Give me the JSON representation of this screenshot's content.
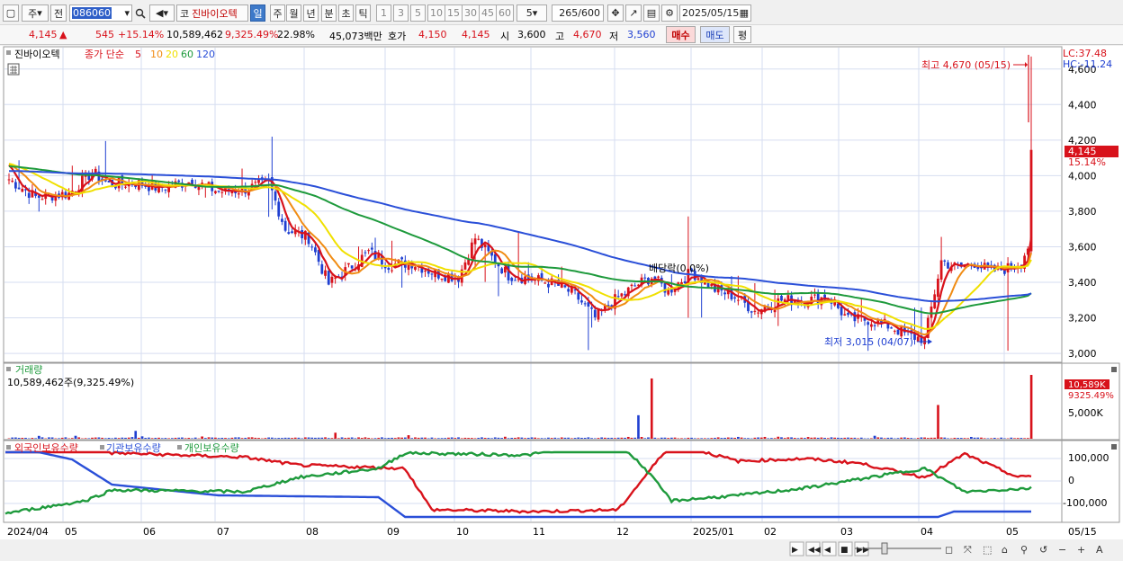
{
  "toolbar": {
    "market": "주",
    "prev": "전",
    "code": "086060",
    "company": "진바이오텍",
    "company_prefix": "코",
    "periods": [
      "일",
      "주",
      "월",
      "년",
      "분",
      "초",
      "틱"
    ],
    "active_period": "일",
    "minutes": [
      "1",
      "3",
      "5",
      "10",
      "15",
      "30",
      "45",
      "60"
    ],
    "minute_value": "5",
    "count": "265",
    "count_max": "/600",
    "date": "2025/05/15"
  },
  "quote": {
    "price": "4,145",
    "change": "545",
    "change_pct": "+15.14%",
    "volume": "10,589,462",
    "volume_pct": "9,325.49%",
    "turnover": "22.98%",
    "amount": "45,073백만",
    "ask_label": "호가",
    "ask1": "4,150",
    "ask2": "4,145",
    "open_label": "시",
    "open": "3,600",
    "high_label": "고",
    "high": "4,670",
    "low_label": "저",
    "low": "3,560",
    "buy": "매수",
    "sell": "매도",
    "eval": "평"
  },
  "price_panel": {
    "name": "진바이오텍",
    "ma_label": "종가 단순",
    "ma_periods": [
      "5",
      "10",
      "20",
      "60",
      "120"
    ],
    "ma_colors": [
      "#d8121b",
      "#f08c14",
      "#f0e000",
      "#1e9a3c",
      "#2a4fd8"
    ],
    "lc": "LC:37.48",
    "hc": "HC:-11.24",
    "last_price": "4,145",
    "last_pct": "15.14%",
    "high_note": "최고 4,670 (05/15)",
    "low_note": "최저 3,015 (04/07)",
    "dividend_note": "배당락(0.0%)"
  },
  "volume_panel": {
    "title": "거래량",
    "value_text": "10,589,462주(9,325.49%)",
    "last_k": "10,589K",
    "last_pct": "9325.49%",
    "tick": "5,000K"
  },
  "holdings_panel": {
    "series_names": [
      "외국인보유수량",
      "기관보유수량",
      "개인보유수량"
    ],
    "series_colors": [
      "#d8121b",
      "#2a4fd8",
      "#1e9a3c"
    ],
    "ticks": [
      "100,000",
      "0",
      "-100,000"
    ]
  },
  "x_axis": {
    "labels": [
      "2024/04",
      "05",
      "06",
      "07",
      "08",
      "09",
      "10",
      "11",
      "12",
      "2025/01",
      "02",
      "03",
      "04",
      "05"
    ],
    "right_label": "05/15"
  },
  "chart_data": {
    "type": "line",
    "title": "진바이오텍",
    "xlabel": "",
    "ylabel": "",
    "ylim": [
      2960,
      4700
    ],
    "y_ticks": [
      3000,
      3200,
      3400,
      3600,
      3800,
      4000,
      4200,
      4400,
      4600
    ],
    "x_months": [
      "2024/04",
      "05",
      "06",
      "07",
      "08",
      "09",
      "10",
      "11",
      "12",
      "2025/01",
      "02",
      "03",
      "04",
      "05"
    ],
    "close_anchors": [
      [
        0,
        3980
      ],
      [
        8,
        3880
      ],
      [
        18,
        3900
      ],
      [
        25,
        4020
      ],
      [
        30,
        3950
      ],
      [
        38,
        3960
      ],
      [
        45,
        3930
      ],
      [
        55,
        3970
      ],
      [
        63,
        3910
      ],
      [
        70,
        3920
      ],
      [
        78,
        3960
      ],
      [
        83,
        3700
      ],
      [
        90,
        3650
      ],
      [
        96,
        3390
      ],
      [
        102,
        3480
      ],
      [
        108,
        3570
      ],
      [
        114,
        3500
      ],
      [
        121,
        3510
      ],
      [
        128,
        3450
      ],
      [
        135,
        3430
      ],
      [
        140,
        3650
      ],
      [
        144,
        3560
      ],
      [
        150,
        3440
      ],
      [
        157,
        3420
      ],
      [
        164,
        3390
      ],
      [
        170,
        3330
      ],
      [
        176,
        3200
      ],
      [
        182,
        3300
      ],
      [
        188,
        3380
      ],
      [
        193,
        3430
      ],
      [
        198,
        3350
      ],
      [
        205,
        3460
      ],
      [
        212,
        3360
      ],
      [
        218,
        3320
      ],
      [
        224,
        3240
      ],
      [
        232,
        3300
      ],
      [
        240,
        3300
      ],
      [
        246,
        3320
      ],
      [
        252,
        3190
      ],
      [
        258,
        3190
      ],
      [
        265,
        3150
      ],
      [
        270,
        3100
      ],
      [
        275,
        3080
      ],
      [
        280,
        3520
      ],
      [
        285,
        3480
      ],
      [
        290,
        3510
      ],
      [
        295,
        3460
      ],
      [
        300,
        3480
      ],
      [
        304,
        3520
      ],
      [
        306,
        3600
      ],
      [
        307,
        4145
      ]
    ],
    "events": {
      "high": 4670,
      "high_date": "05/15",
      "low": 3015,
      "low_date": "04/07",
      "last": 4145
    },
    "volume_spikes": [
      {
        "month": "11",
        "value": 10000
      },
      {
        "month": "04",
        "value": 5600
      },
      {
        "month": "05/15",
        "value": 10589
      }
    ],
    "holdings": {
      "series": [
        {
          "name": "외국인보유수량",
          "anchors": [
            [
              0,
              1
            ],
            [
              30,
              0.9
            ],
            [
              40,
              0.78
            ],
            [
              90,
              0.66
            ],
            [
              110,
              0.44
            ],
            [
              150,
              0.35
            ],
            [
              160,
              -0.8
            ],
            [
              200,
              -0.85
            ],
            [
              230,
              -0.8
            ],
            [
              250,
              1.05
            ],
            [
              275,
              0.55
            ],
            [
              300,
              0.62
            ],
            [
              320,
              0.5
            ],
            [
              345,
              0.1
            ],
            [
              360,
              0.75
            ],
            [
              380,
              0.1
            ],
            [
              385,
              0.15
            ]
          ]
        },
        {
          "name": "기관보유수량",
          "anchors": [
            [
              0,
              1
            ],
            [
              25,
              0.6
            ],
            [
              40,
              -0.1
            ],
            [
              80,
              -0.4
            ],
            [
              140,
              -0.45
            ],
            [
              150,
              -1.0
            ],
            [
              350,
              -1.0
            ],
            [
              356,
              -0.85
            ],
            [
              385,
              -0.85
            ]
          ]
        },
        {
          "name": "개인보유수량",
          "anchors": [
            [
              0,
              -0.9
            ],
            [
              30,
              -0.55
            ],
            [
              40,
              -0.25
            ],
            [
              90,
              -0.3
            ],
            [
              110,
              0.1
            ],
            [
              140,
              0.35
            ],
            [
              150,
              0.78
            ],
            [
              195,
              0.72
            ],
            [
              230,
              1.05
            ],
            [
              240,
              0.35
            ],
            [
              250,
              -0.55
            ],
            [
              275,
              -0.4
            ],
            [
              300,
              -0.2
            ],
            [
              345,
              0.35
            ],
            [
              360,
              -0.3
            ],
            [
              385,
              -0.2
            ]
          ]
        }
      ]
    }
  }
}
